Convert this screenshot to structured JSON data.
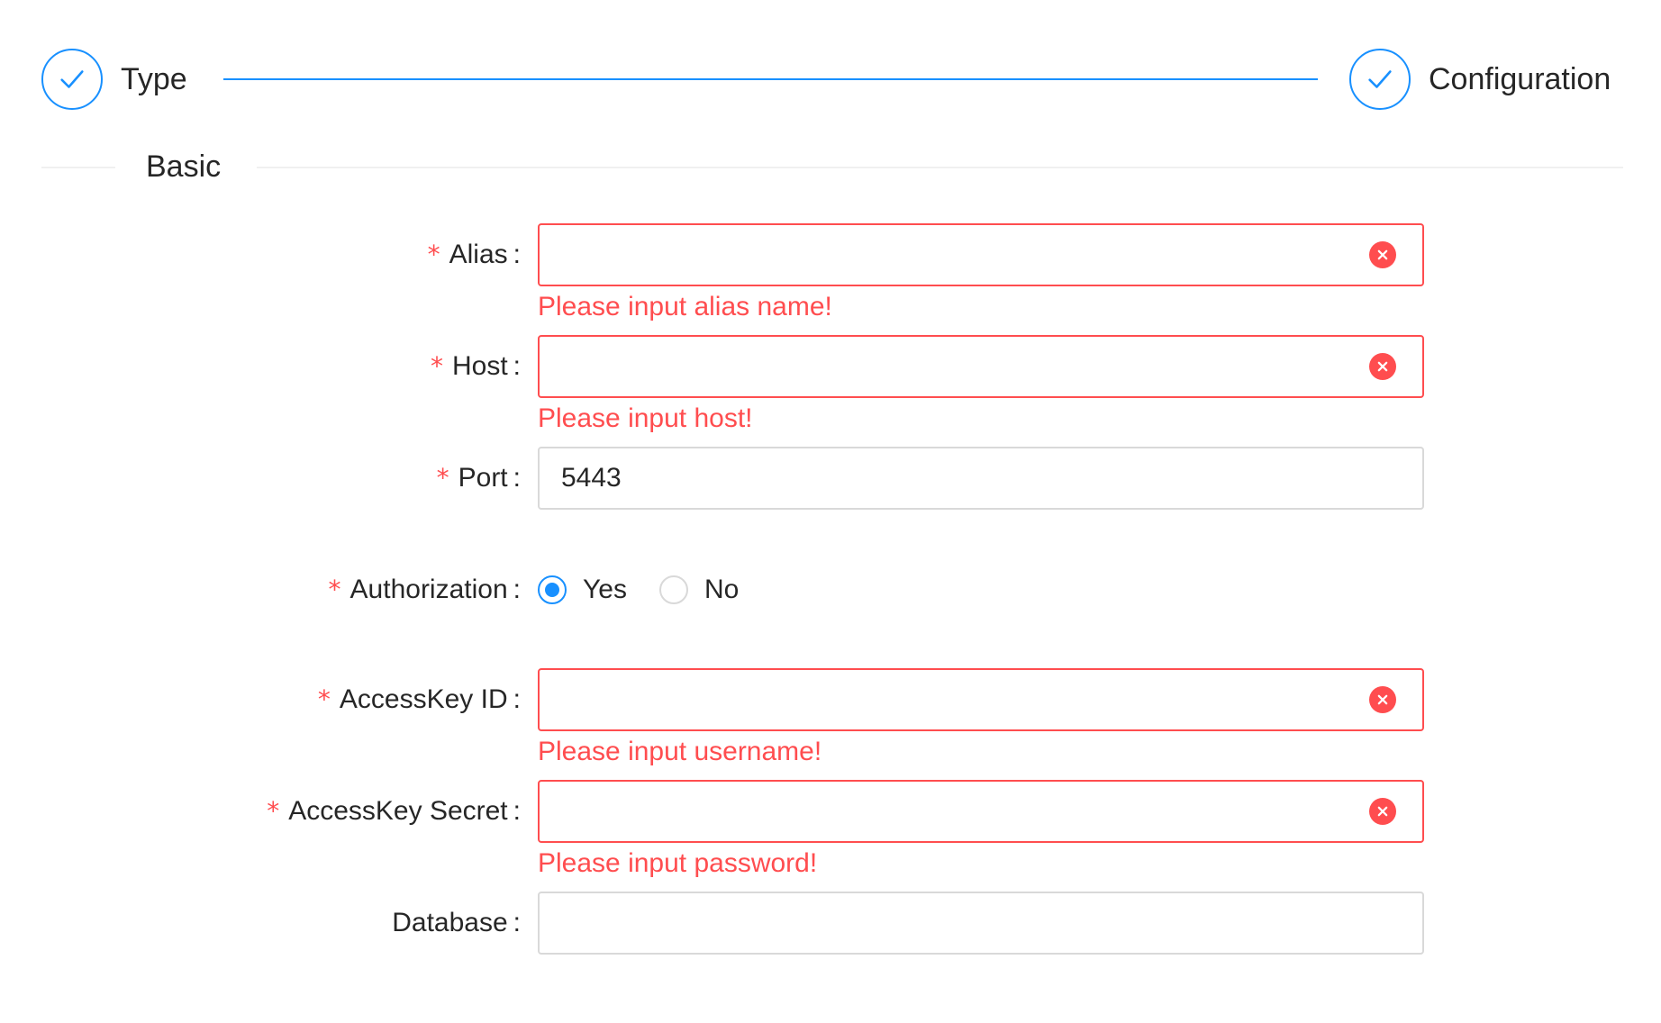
{
  "steps": [
    {
      "title": "Type",
      "status": "finished"
    },
    {
      "title": "Configuration",
      "status": "finished"
    }
  ],
  "section": {
    "title": "Basic"
  },
  "colors": {
    "primary": "#1890ff",
    "error": "#ff4d4f",
    "border": "#d9d9d9"
  },
  "form": {
    "alias": {
      "label": "Alias",
      "value": "",
      "error": "Please input alias name!",
      "required": true
    },
    "host": {
      "label": "Host",
      "value": "",
      "error": "Please input host!",
      "required": true
    },
    "port": {
      "label": "Port",
      "value": "5443",
      "required": true
    },
    "authorization": {
      "label": "Authorization",
      "required": true,
      "options": [
        {
          "label": "Yes",
          "checked": true
        },
        {
          "label": "No",
          "checked": false
        }
      ]
    },
    "access_key_id": {
      "label": "AccessKey ID",
      "value": "",
      "error": "Please input username!",
      "required": true
    },
    "access_key_secret": {
      "label": "AccessKey Secret",
      "value": "",
      "error": "Please input password!",
      "required": true
    },
    "database": {
      "label": "Database",
      "value": "",
      "required": false
    }
  },
  "icons": {
    "step_done": "check-icon",
    "field_error": "close-circle-icon"
  }
}
